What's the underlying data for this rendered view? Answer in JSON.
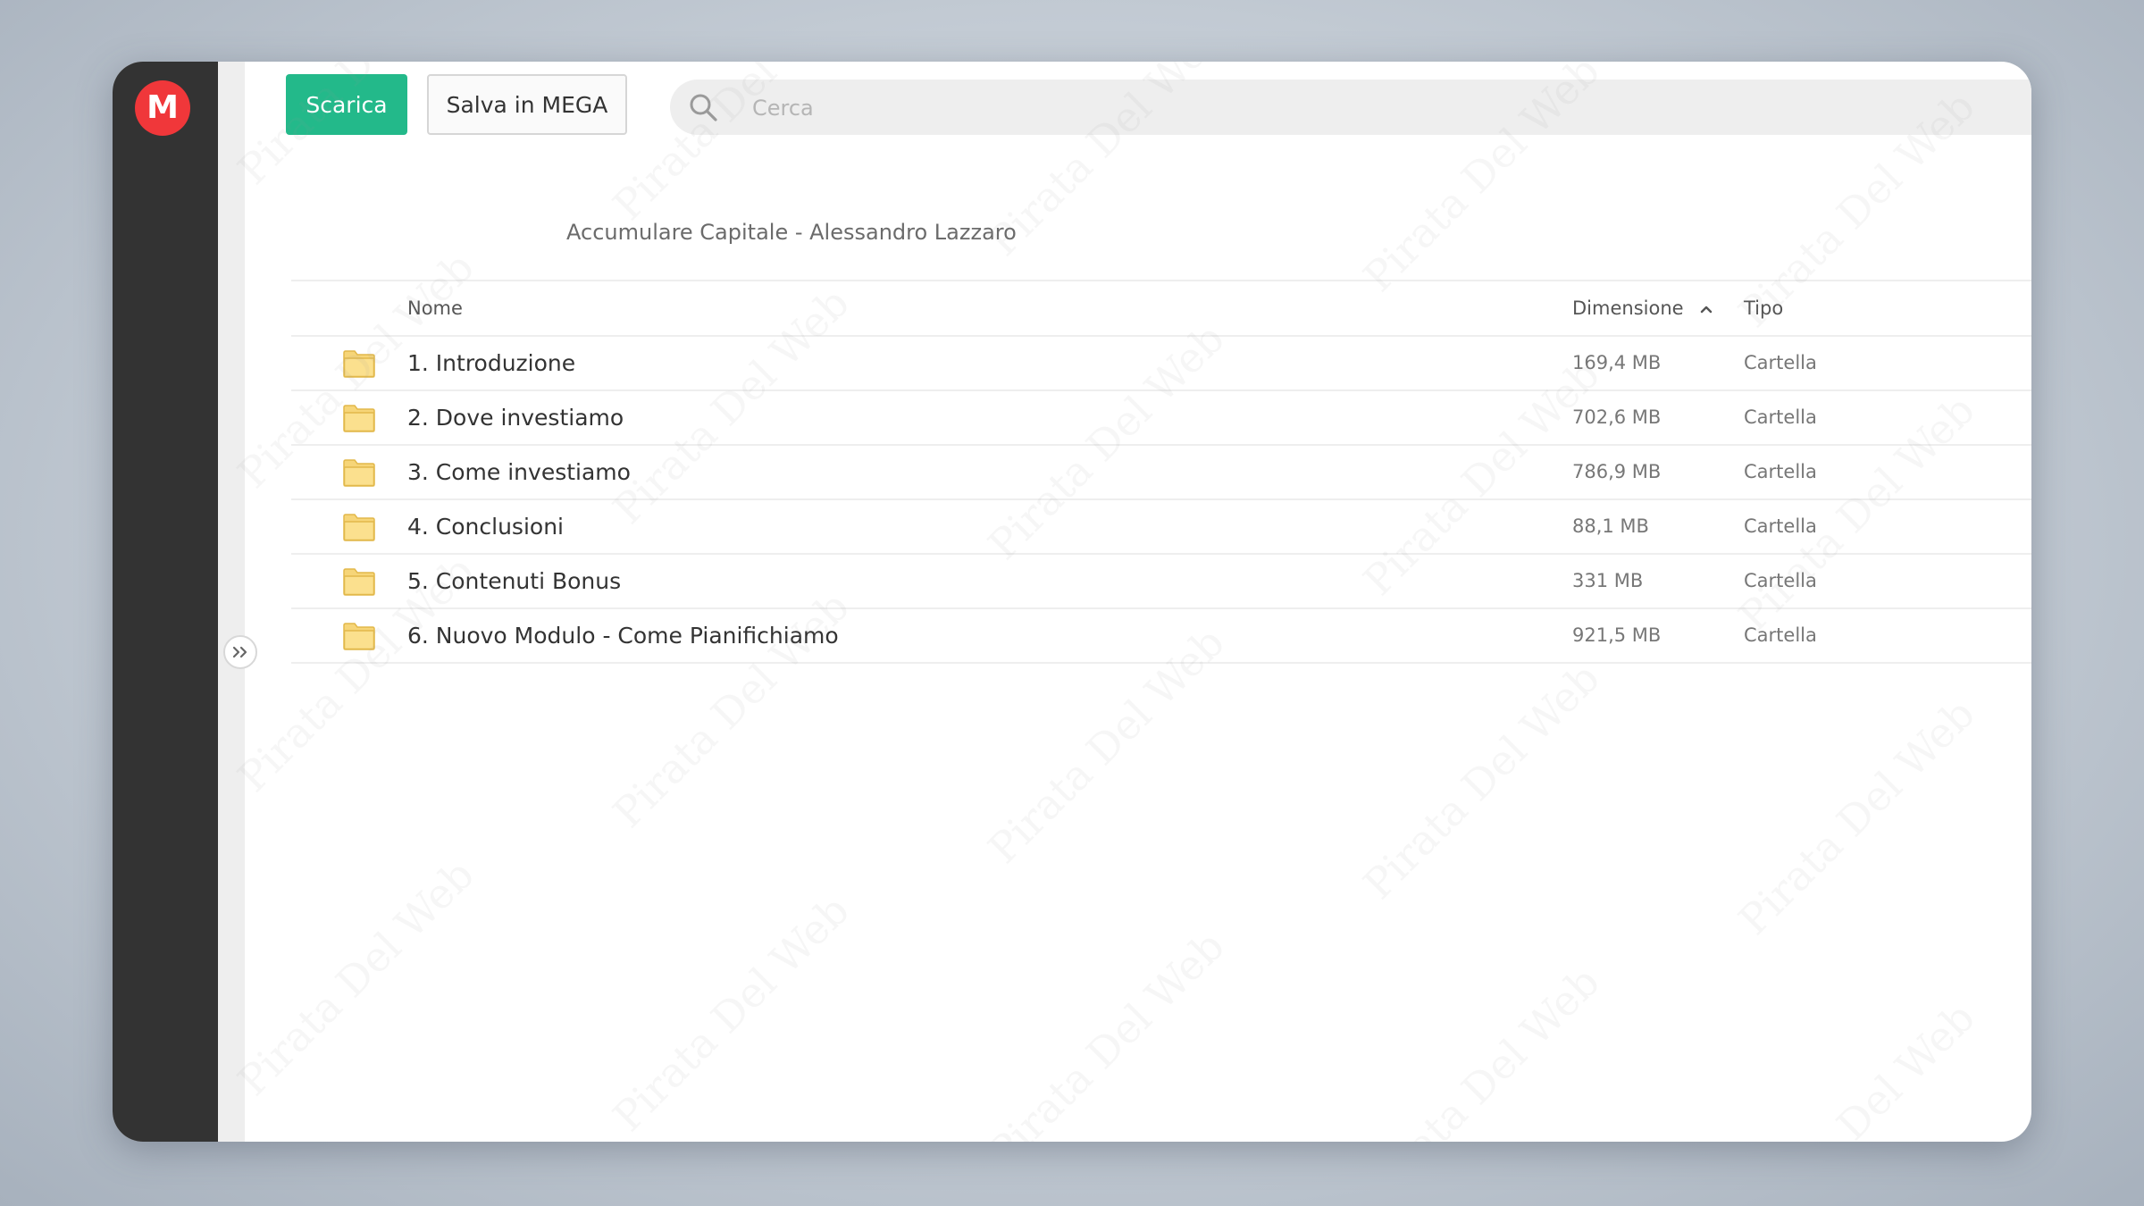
{
  "app": {
    "logo_letter": "M",
    "brand_color": "#f0373a"
  },
  "toolbar": {
    "download_label": "Scarica",
    "download_color": "#23b98a",
    "save_label": "Salva in MEGA"
  },
  "search": {
    "placeholder": "Cerca",
    "value": ""
  },
  "breadcrumb": {
    "path": "Accumulare Capitale - Alessandro Lazzaro"
  },
  "table": {
    "columns": {
      "name": "Nome",
      "size": "Dimensione",
      "type": "Tipo"
    },
    "sort": "ascending",
    "rows": [
      {
        "name": "1. Introduzione",
        "size": "169,4 MB",
        "type": "Cartella",
        "icon": "folder-icon"
      },
      {
        "name": "2. Dove investiamo",
        "size": "702,6 MB",
        "type": "Cartella",
        "icon": "folder-icon"
      },
      {
        "name": "3. Come investiamo",
        "size": "786,9 MB",
        "type": "Cartella",
        "icon": "folder-icon"
      },
      {
        "name": "4. Conclusioni",
        "size": "88,1 MB",
        "type": "Cartella",
        "icon": "folder-icon"
      },
      {
        "name": "5. Contenuti Bonus",
        "size": "331 MB",
        "type": "Cartella",
        "icon": "folder-icon"
      },
      {
        "name": "6. Nuovo Modulo - Come Pianifichiamo",
        "size": "921,5 MB",
        "type": "Cartella",
        "icon": "folder-icon"
      }
    ]
  },
  "watermark_text": "Pirata Del Web"
}
